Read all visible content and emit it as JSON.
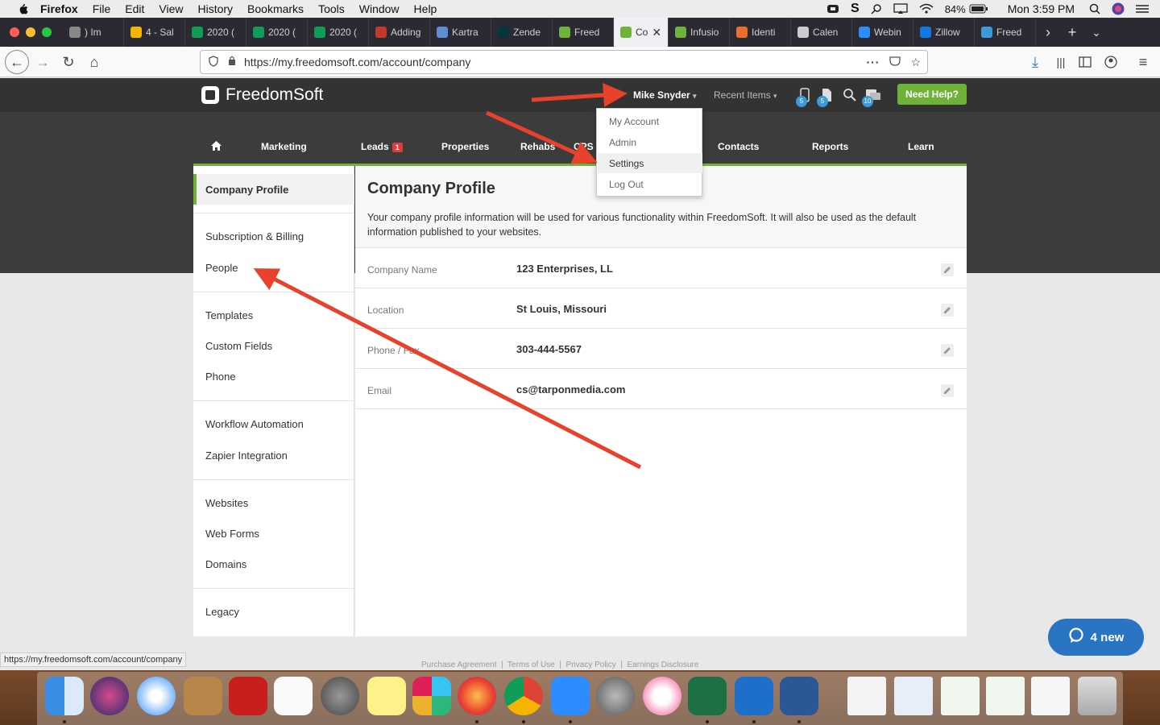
{
  "menubar": {
    "items": [
      "Firefox",
      "File",
      "Edit",
      "View",
      "History",
      "Bookmarks",
      "Tools",
      "Window",
      "Help"
    ],
    "battery": "84%",
    "clock": "Mon 3:59 PM"
  },
  "tabs": [
    {
      "label": ") Im",
      "color": "#888888"
    },
    {
      "label": "4 - Sal",
      "color": "#f4b400"
    },
    {
      "label": "2020 (",
      "color": "#0f9d58"
    },
    {
      "label": "2020 (",
      "color": "#0f9d58"
    },
    {
      "label": "2020 (",
      "color": "#0f9d58"
    },
    {
      "label": "Adding",
      "color": "#c0392b"
    },
    {
      "label": "Kartra",
      "color": "#5b8fd1"
    },
    {
      "label": "Zende",
      "color": "#03363d"
    },
    {
      "label": "Freed",
      "color": "#6fb23a"
    },
    {
      "label": "Co",
      "color": "#6fb23a"
    },
    {
      "label": "Infusio",
      "color": "#6fb23a"
    },
    {
      "label": "Identi",
      "color": "#e8702a"
    },
    {
      "label": "Calen",
      "color": "#cccccc"
    },
    {
      "label": "Webin",
      "color": "#2d8cff"
    },
    {
      "label": "Zillow",
      "color": "#1277e1"
    },
    {
      "label": "Freed",
      "color": "#3b9ad9"
    }
  ],
  "browser": {
    "url": "https://my.freedomsoft.com/account/company",
    "status_url": "https://my.freedomsoft.com/account/company"
  },
  "app": {
    "logo_text": "FreedomSoft",
    "user_name": "Mike Snyder",
    "recent_items": "Recent Items",
    "need_help": "Need Help?",
    "icon_badges": [
      "5",
      "5",
      "10"
    ],
    "nav": [
      {
        "label": "Marketing",
        "badge": ""
      },
      {
        "label": "Leads",
        "badge": "1"
      },
      {
        "label": "Properties",
        "badge": ""
      },
      {
        "label": "Rehabs",
        "badge": ""
      },
      {
        "label": "CPS",
        "badge": ""
      },
      {
        "label": "Contacts",
        "badge": ""
      },
      {
        "label": "Reports",
        "badge": ""
      },
      {
        "label": "Learn",
        "badge": ""
      }
    ],
    "dropdown": [
      "My Account",
      "Admin",
      "Settings",
      "Log Out"
    ]
  },
  "sidebar": {
    "active": "Company Profile",
    "groups": [
      [
        "Company Profile"
      ],
      [
        "Subscription & Billing",
        "People"
      ],
      [
        "Templates",
        "Custom Fields",
        "Phone"
      ],
      [
        "Workflow Automation",
        "Zapier Integration"
      ],
      [
        "Websites",
        "Web Forms",
        "Domains"
      ],
      [
        "Legacy"
      ]
    ]
  },
  "main": {
    "title": "Company Profile",
    "description": "Your company profile information will be used for various functionality within FreedomSoft. It will also be used as the default information published to your websites.",
    "fields": [
      {
        "label": "Company Name",
        "value": "123 Enterprises, LL"
      },
      {
        "label": "Location",
        "value": "St Louis, Missouri"
      },
      {
        "label": "Phone / Fax",
        "value": "303-444-5567"
      },
      {
        "label": "Email",
        "value": "cs@tarponmedia.com"
      }
    ]
  },
  "footer": {
    "links": [
      "Purchase Agreement",
      "Terms of Use",
      "Privacy Policy",
      "Earnings Disclosure"
    ]
  },
  "chat": {
    "label": "4 new"
  },
  "colors": {
    "brand_green": "#6fb23a",
    "header_dark": "#333333",
    "arrow_red": "#e8412c",
    "chat_blue": "#2a74c4"
  }
}
